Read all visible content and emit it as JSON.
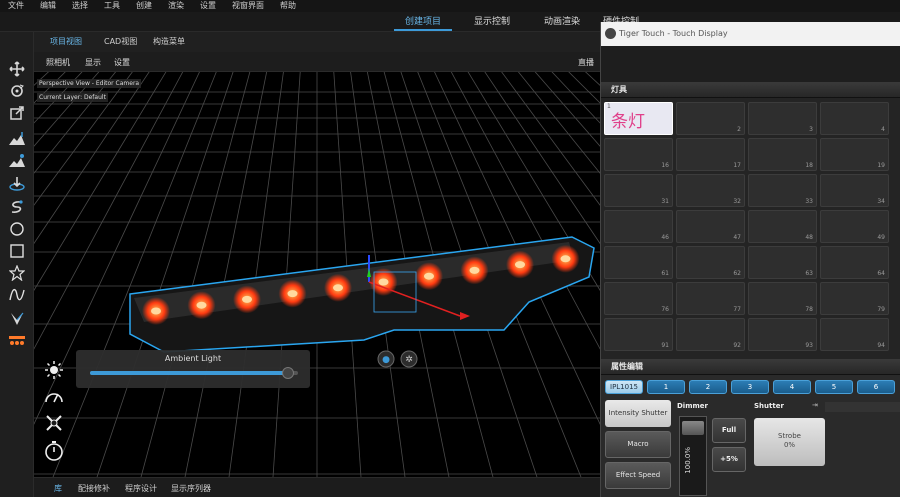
{
  "menu": [
    "文件",
    "编辑",
    "选择",
    "工具",
    "创建",
    "渲染",
    "设置",
    "视窗界面",
    "帮助"
  ],
  "mode_tabs": [
    {
      "label": "创建项目",
      "active": true
    },
    {
      "label": "显示控制",
      "active": false
    },
    {
      "label": "动画渲染",
      "active": false
    },
    {
      "label": "硬件控制",
      "active": false
    }
  ],
  "view_tabs": [
    {
      "label": "项目视图",
      "active": true
    },
    {
      "label": "CAD视图",
      "active": false
    },
    {
      "label": "构造菜单",
      "active": false
    }
  ],
  "sub_menu": [
    "照相机",
    "显示",
    "设置"
  ],
  "sub_right": "直播",
  "viewport": {
    "camera_label": "Perspective View - Editor Camera",
    "layer_label": "Current Layer: Default"
  },
  "ambient": {
    "label": "Ambient Light",
    "level": 0.95
  },
  "bottom_tabs": [
    {
      "label": "库",
      "active": true
    },
    {
      "label": "配接修补",
      "active": false
    },
    {
      "label": "程序设计",
      "active": false
    },
    {
      "label": "显示序列器",
      "active": false
    }
  ],
  "touch": {
    "title": "Tiger Touch - Touch Display",
    "fixtures_header": "灯具",
    "selected_fixture": {
      "index": "1",
      "label": "条灯"
    },
    "grid_numbers": [
      [
        "",
        "2",
        "3",
        "4"
      ],
      [
        "16",
        "17",
        "18",
        "19"
      ],
      [
        "31",
        "32",
        "33",
        "34"
      ],
      [
        "46",
        "47",
        "48",
        "49"
      ],
      [
        "61",
        "62",
        "63",
        "64"
      ],
      [
        "76",
        "77",
        "78",
        "79"
      ],
      [
        "91",
        "92",
        "93",
        "94"
      ]
    ],
    "attr_header": "属性编辑",
    "attr_tabs": [
      "IPL1015",
      "1",
      "2",
      "3",
      "4",
      "5",
      "6"
    ],
    "groups": [
      "Intensity Shutter",
      "Macro",
      "Effect Speed"
    ],
    "dimmer_label": "Dimmer",
    "dimmer_value": "100.0%",
    "full_label": "Full",
    "plus5_label": "+5%",
    "shutter_label": "Shutter",
    "strobe_label": "Strobe",
    "strobe_value": "0%"
  },
  "colors": {
    "accent": "#3d9ad8",
    "fixture_glow": "#ff4a1a",
    "outline": "#2aa6f0"
  }
}
